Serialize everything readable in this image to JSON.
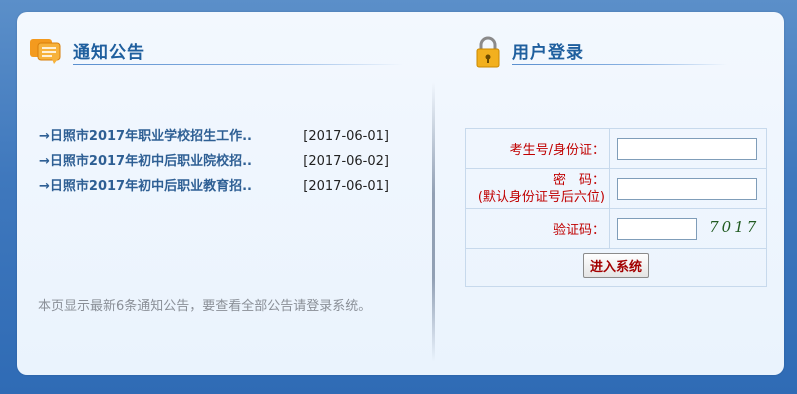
{
  "notice": {
    "title": "通知公告",
    "items": [
      {
        "title": "→日照市2017年职业学校招生工作..",
        "date": "[2017-06-01]"
      },
      {
        "title": "→日照市2017年初中后职业院校招..",
        "date": "[2017-06-02]"
      },
      {
        "title": "→日照市2017年初中后职业教育招..",
        "date": "[2017-06-01]"
      }
    ],
    "footnote": "本页显示最新6条通知公告，要查看全部公告请登录系统。"
  },
  "login": {
    "title": "用户登录",
    "id_label": "考生号/身份证：",
    "password_label": "密　码：",
    "password_hint": "(默认身份证号后六位)",
    "captcha_label": "验证码：",
    "captcha_text": "7017",
    "submit_label": "进入系统",
    "id_value": "",
    "password_value": "",
    "captcha_value": ""
  },
  "colors": {
    "accent": "#1f5f9e",
    "label_red": "#c00000",
    "link": "#2e5f94"
  },
  "icons": {
    "notice": "speech-bubble-icon",
    "login": "padlock-icon"
  }
}
